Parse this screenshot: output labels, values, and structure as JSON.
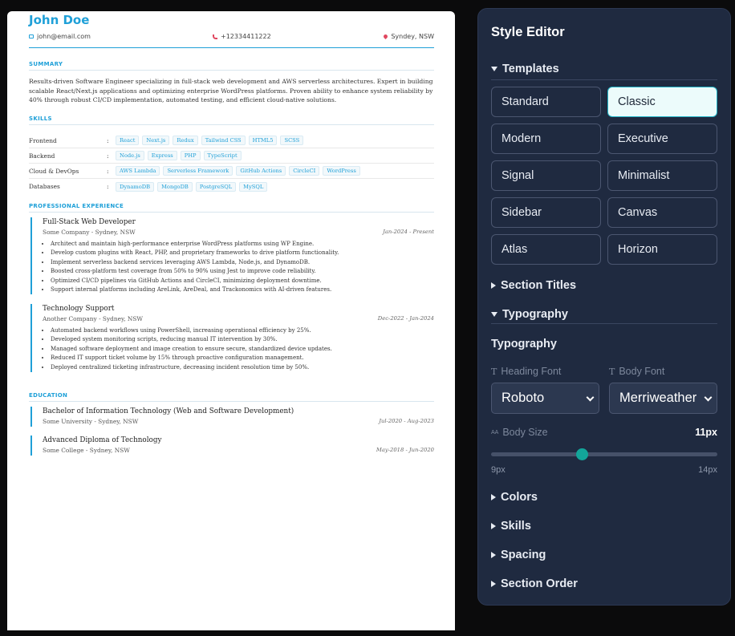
{
  "resume": {
    "name": "John Doe",
    "contact": {
      "email": "john@email.com",
      "phone": "+12334411222",
      "location": "Syndey, NSW"
    },
    "sections": {
      "summary": "SUMMARY",
      "skills": "SKILLS",
      "experience": "PROFESSIONAL EXPERIENCE",
      "education": "EDUCATION"
    },
    "summary": "Results-driven Software Engineer specializing in full-stack web development and AWS serverless architectures. Expert in building scalable React/Next.js applications and optimizing enterprise WordPress platforms. Proven ability to enhance system reliability by 40% through robust CI/CD implementation, automated testing, and efficient cloud-native solutions.",
    "skills": [
      {
        "category": "Frontend",
        "items": [
          "React",
          "Next.js",
          "Redux",
          "Tailwind CSS",
          "HTML5",
          "SCSS"
        ]
      },
      {
        "category": "Backend",
        "items": [
          "Node.js",
          "Express",
          "PHP",
          "TypeScript"
        ]
      },
      {
        "category": "Cloud & DevOps",
        "items": [
          "AWS Lambda",
          "Serverless Framework",
          "GitHub Actions",
          "CircleCI",
          "WordPress"
        ]
      },
      {
        "category": "Databases",
        "items": [
          "DynamoDB",
          "MongoDB",
          "PostgreSQL",
          "MySQL"
        ]
      }
    ],
    "experience": [
      {
        "title": "Full-Stack Web Developer",
        "company": "Some Company - Sydney, NSW",
        "dates": "Jan-2024 - Present",
        "bullets": [
          "Architect and maintain high-performance enterprise WordPress platforms using WP Engine.",
          "Develop custom plugins with React, PHP, and proprietary frameworks to drive platform functionality.",
          "Implement serverless backend services leveraging AWS Lambda, Node.js, and DynamoDB.",
          "Boosted cross-platform test coverage from 50% to 90% using Jest to improve code reliability.",
          "Optimized CI/CD pipelines via GitHub Actions and CircleCI, minimizing deployment downtime.",
          "Support internal platforms including AreLink, AreDeal, and Trackonomics with AI-driven features."
        ]
      },
      {
        "title": "Technology Support",
        "company": "Another Company - Sydney, NSW",
        "dates": "Dec-2022 - Jan-2024",
        "bullets": [
          "Automated backend workflows using PowerShell, increasing operational efficiency by 25%.",
          "Developed system monitoring scripts, reducing manual IT intervention by 30%.",
          "Managed software deployment and image creation to ensure secure, standardized device updates.",
          "Reduced IT support ticket volume by 15% through proactive configuration management.",
          "Deployed centralized ticketing infrastructure, decreasing incident resolution time by 50%."
        ]
      }
    ],
    "education": [
      {
        "degree": "Bachelor of Information Technology (Web and Software Development)",
        "school": "Some University - Sydney, NSW",
        "dates": "Jul-2020 - Aug-2023"
      },
      {
        "degree": "Advanced Diploma of Technology",
        "school": "Some College - Sydney, NSW",
        "dates": "May-2018 - Jun-2020"
      }
    ]
  },
  "editor": {
    "title": "Style Editor",
    "templates_label": "Templates",
    "templates": [
      "Standard",
      "Classic",
      "Modern",
      "Executive",
      "Signal",
      "Minimalist",
      "Sidebar",
      "Canvas",
      "Atlas",
      "Horizon"
    ],
    "selected_template": "Classic",
    "section_titles_label": "Section Titles",
    "typography_label": "Typography",
    "typography_heading": "Typography",
    "heading_font_label": "Heading Font",
    "body_font_label": "Body Font",
    "heading_font": "Roboto",
    "body_font": "Merriweather",
    "body_size_label": "Body Size",
    "body_size_value": "11px",
    "body_size": 11,
    "body_size_min": 9,
    "body_size_max": 14,
    "range_min_label": "9px",
    "range_max_label": "14px",
    "colors_label": "Colors",
    "skills_label": "Skills",
    "spacing_label": "Spacing",
    "section_order_label": "Section Order"
  },
  "colors": {
    "accent": "#1fa0d8",
    "panel": "#1f2a40",
    "active_template_bg": "#ecfbfb",
    "slider_thumb": "#13a59a"
  }
}
